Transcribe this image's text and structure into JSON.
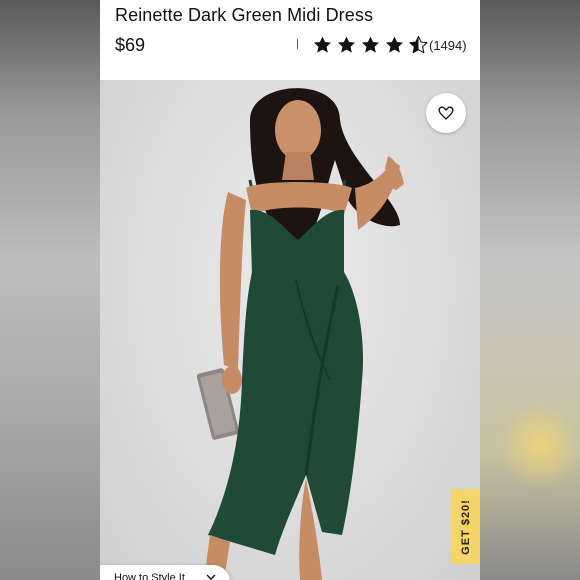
{
  "product": {
    "title": "Reinette Dark Green Midi Dress",
    "price": "$69",
    "rating": 4.5,
    "rating_max": 5,
    "review_count": "(1494)"
  },
  "icons": {
    "favorite": "heart-icon",
    "stars": "star-icon",
    "style_chevron": "chevron-down-icon"
  },
  "promo": {
    "label": "GET $20!"
  },
  "style_link": {
    "label": "How to Style It"
  },
  "colors": {
    "dress": "#1f4a35",
    "promo_tab": "#f5d46a",
    "photo_background": "#dcdcdc"
  }
}
